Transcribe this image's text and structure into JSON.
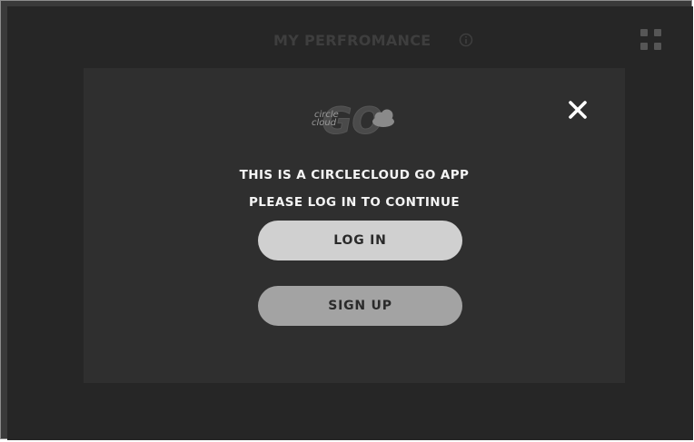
{
  "header": {
    "title": "MY PERFROMANCE",
    "info_icon": "info-icon",
    "menu_icon": "grid-icon"
  },
  "modal": {
    "close_icon": "close-icon",
    "logo": {
      "text_line1": "circle",
      "text_line2": "cloud",
      "mark": "GO",
      "icon": "cloud-icon"
    },
    "message_line1": "THIS IS A CIRCLECLOUD GO APP",
    "message_line2": "PLEASE LOG IN TO CONTINUE",
    "login_label": "LOG IN",
    "signup_label": "SIGN UP"
  },
  "colors": {
    "background": "#262626",
    "modal": "#2f2f2f",
    "login_button": "#d0d0d0",
    "signup_button": "#a3a3a3",
    "text": "#f5f5f5"
  }
}
